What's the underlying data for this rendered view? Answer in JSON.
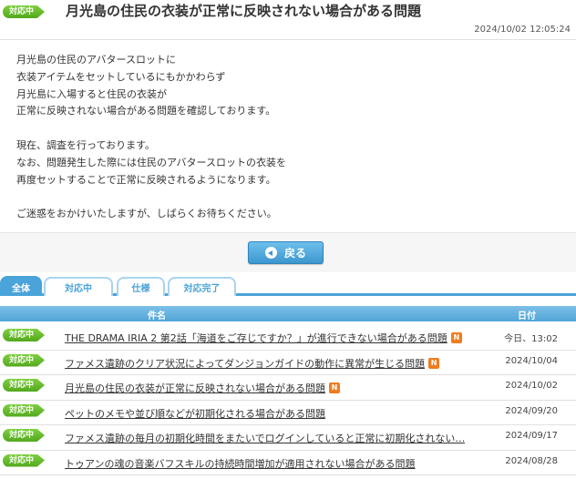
{
  "header": {
    "badge": "対応中",
    "title": "月光島の住民の衣装が正常に反映されない場合がある問題",
    "datetime": "2024/10/02 12:05:24"
  },
  "body": {
    "paragraphs": [
      [
        "月光島の住民のアバタースロットに",
        "衣装アイテムをセットしているにもかかわらず",
        "月光島に入場すると住民の衣装が",
        "正常に反映されない場合がある問題を確認しております。"
      ],
      [
        "現在、調査を行っております。",
        "なお、問題発生した際には住民のアバタースロットの衣装を",
        "再度セットすることで正常に反映されるようになります。"
      ],
      [
        "ご迷惑をおかけいたしますが、しばらくお待ちください。"
      ]
    ]
  },
  "back_button": {
    "label": "戻る"
  },
  "tabs": [
    {
      "label": "全体",
      "active": true
    },
    {
      "label": "対応中",
      "active": false
    },
    {
      "label": "仕様",
      "active": false
    },
    {
      "label": "対応完了",
      "active": false
    }
  ],
  "table": {
    "headers": {
      "name": "件名",
      "date": "日付"
    },
    "rows": [
      {
        "badge": "対応中",
        "title": "THE DRAMA IRIA 2 第2話「海道をご存じですか？」が進行できない場合がある問題",
        "new": "N",
        "date": "今日、13:02"
      },
      {
        "badge": "対応中",
        "title": "ファメス遺跡のクリア状況によってダンジョンガイドの動作に異常が生じる問題",
        "new": "N",
        "date": "2024/10/04"
      },
      {
        "badge": "対応中",
        "title": "月光島の住民の衣装が正常に反映されない場合がある問題",
        "new": "N",
        "date": "2024/10/02"
      },
      {
        "badge": "対応中",
        "title": "ペットのメモや並び順などが初期化される場合がある問題",
        "new": "",
        "date": "2024/09/20"
      },
      {
        "badge": "対応中",
        "title": "ファメス遺跡の毎月の初期化時間をまたいでログインしていると正常に初期化されない…",
        "new": "",
        "date": "2024/09/17"
      },
      {
        "badge": "対応中",
        "title": "トゥアンの魂の音楽バフスキルの持続時間増加が適用されない場合がある問題",
        "new": "",
        "date": "2024/08/28"
      }
    ]
  }
}
